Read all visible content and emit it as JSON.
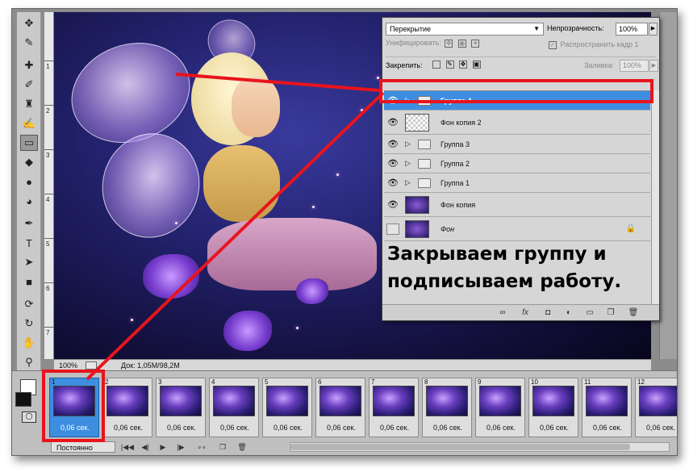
{
  "layers_panel": {
    "blend_mode": "Перекрытие",
    "opacity_label": "Непрозрачность:",
    "opacity_value": "100%",
    "unify_label": "Унифицировать:",
    "propagate_label": "Распространить кадр 1",
    "lock_label": "Закрепить:",
    "fill_label": "Заливка:",
    "fill_value": "100%",
    "layers": [
      {
        "name": "Группа 4",
        "type": "group",
        "visible": true,
        "selected": true
      },
      {
        "name": "Фон копия 2",
        "type": "layer",
        "visible": true,
        "selected": false
      },
      {
        "name": "Группа 3",
        "type": "group",
        "visible": true,
        "selected": false
      },
      {
        "name": "Группа 2",
        "type": "group",
        "visible": true,
        "selected": false
      },
      {
        "name": "Группа 1",
        "type": "group",
        "visible": true,
        "selected": false
      },
      {
        "name": "Фон копия",
        "type": "layer",
        "visible": true,
        "selected": false
      },
      {
        "name": "Фон",
        "type": "background",
        "visible": false,
        "selected": false,
        "locked": true
      }
    ]
  },
  "caption": "Закрываем группу и подписываем работу.",
  "statusbar": {
    "zoom": "100%",
    "doc_info": "Док: 1,05M/98,2M"
  },
  "ruler_numbers": [
    "1",
    "2",
    "3",
    "4",
    "5",
    "6",
    "7"
  ],
  "timeline": {
    "frames": [
      {
        "num": "1",
        "delay": "0,06 сек.",
        "active": true
      },
      {
        "num": "2",
        "delay": "0,06 сек.",
        "active": false
      },
      {
        "num": "3",
        "delay": "0,06 сек.",
        "active": false
      },
      {
        "num": "4",
        "delay": "0,06 сек.",
        "active": false
      },
      {
        "num": "5",
        "delay": "0,06 сек.",
        "active": false
      },
      {
        "num": "6",
        "delay": "0,06 сек.",
        "active": false
      },
      {
        "num": "7",
        "delay": "0,06 сек.",
        "active": false
      },
      {
        "num": "8",
        "delay": "0,06 сек.",
        "active": false
      },
      {
        "num": "9",
        "delay": "0,06 сек.",
        "active": false
      },
      {
        "num": "10",
        "delay": "0,06 сек.",
        "active": false
      },
      {
        "num": "11",
        "delay": "0,06 сек.",
        "active": false
      },
      {
        "num": "12",
        "delay": "0,06 сек.",
        "active": false
      }
    ],
    "loop": "Постоянно"
  },
  "colors": {
    "annotation_red": "#e8141d",
    "selection_blue": "#3d8ee0"
  }
}
